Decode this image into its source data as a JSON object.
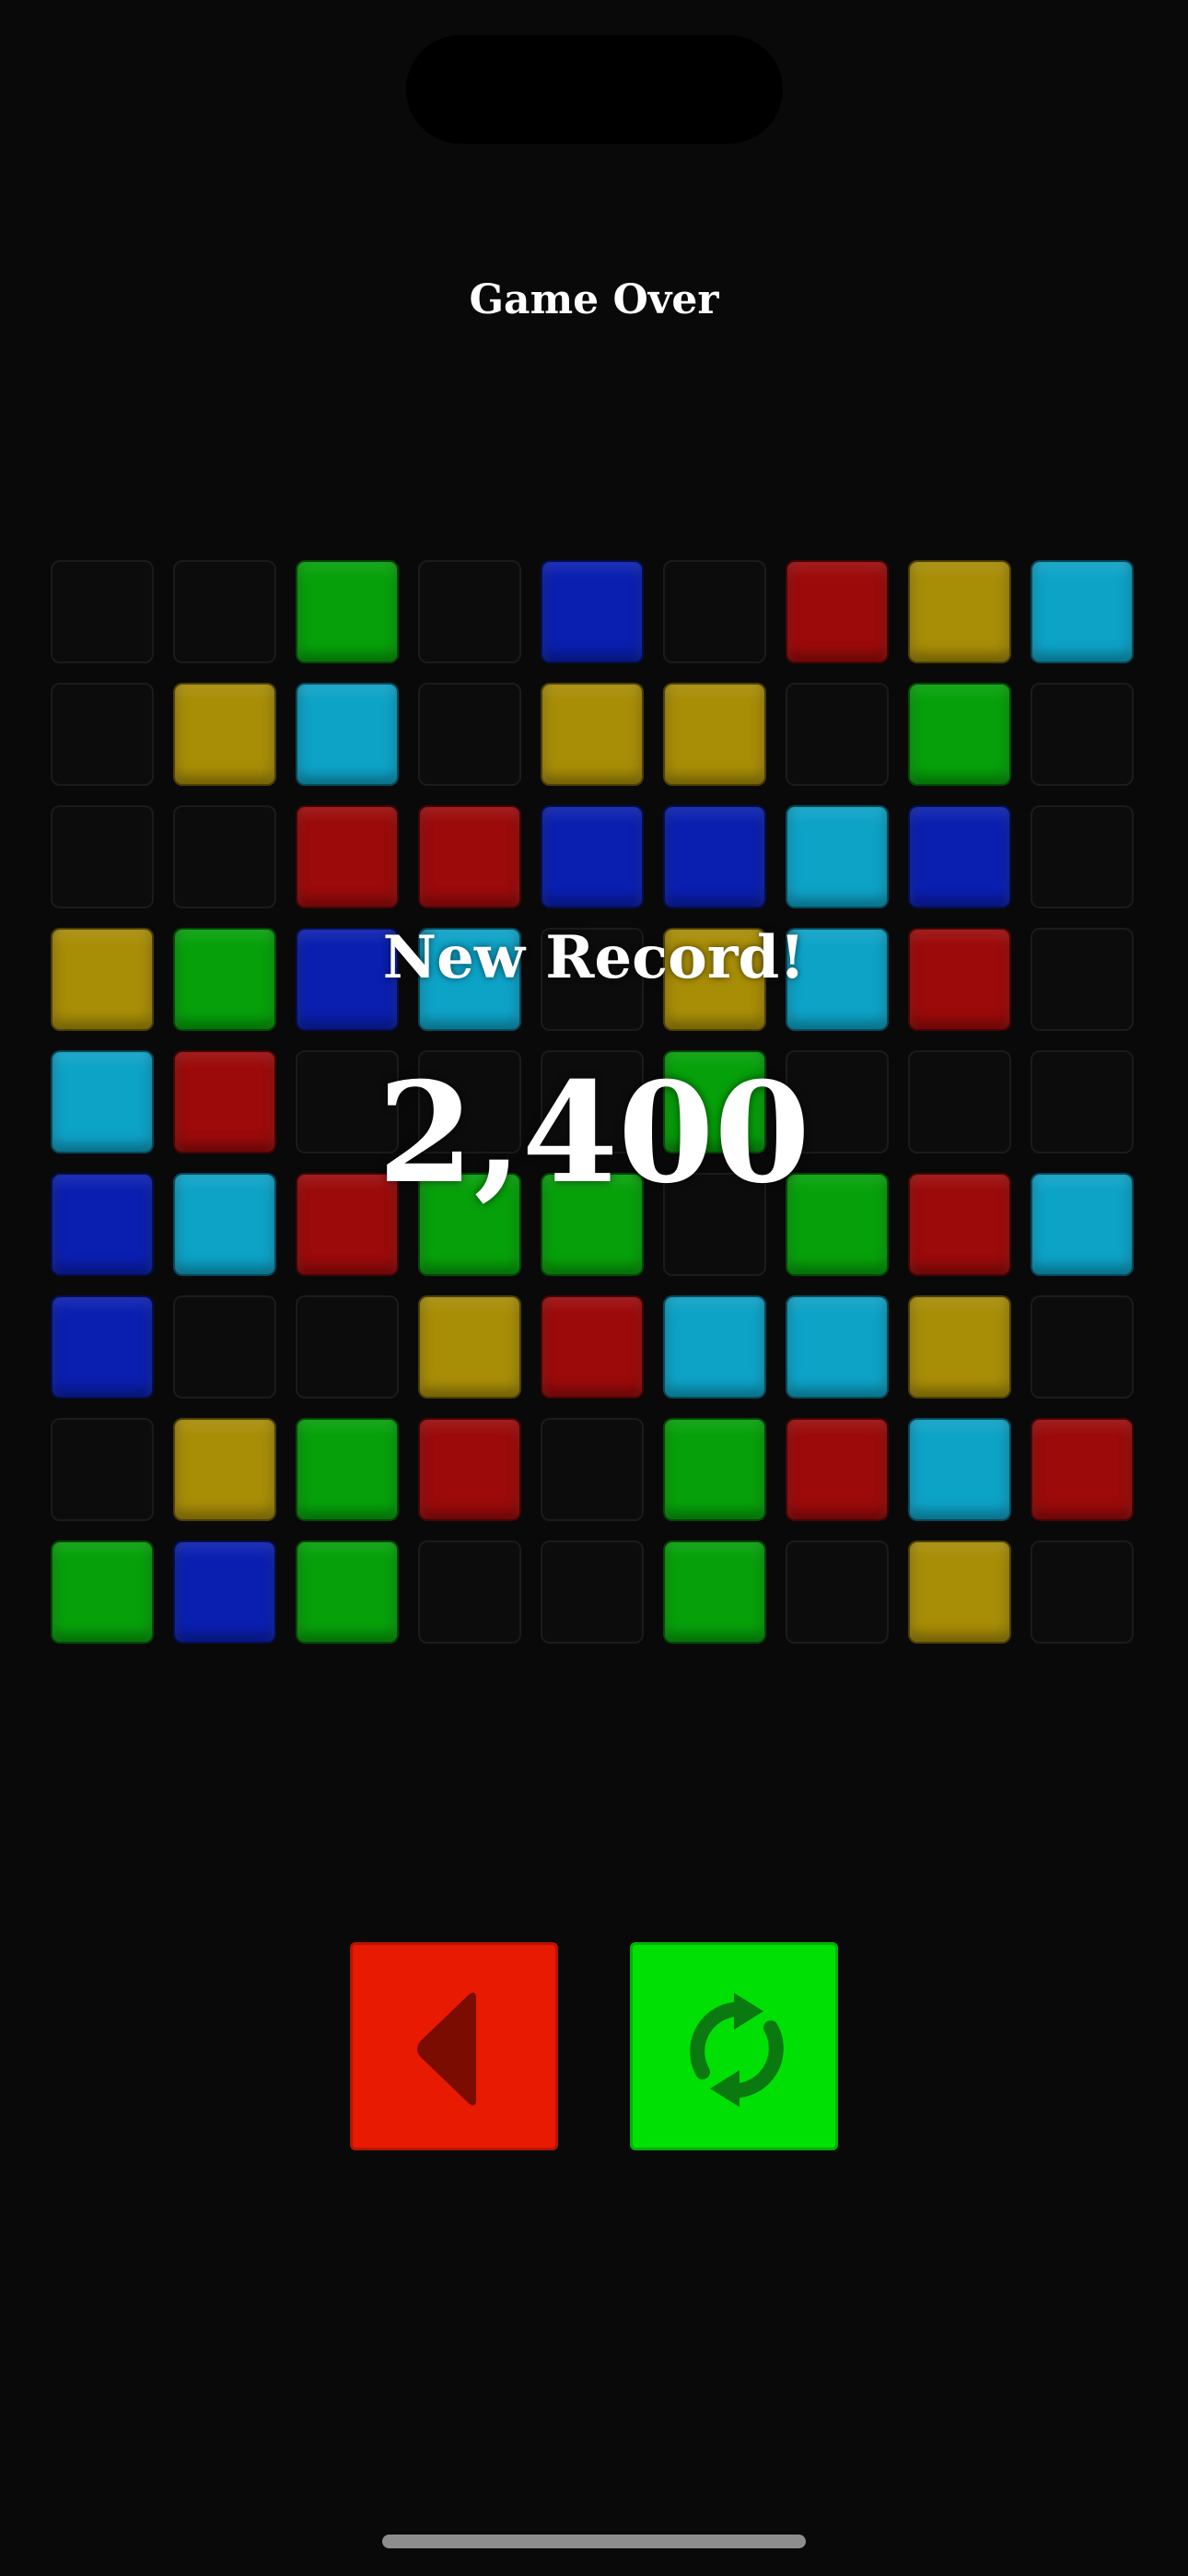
{
  "screen": {
    "title": "Game Over",
    "record_label": "New Record!",
    "score": "2,400"
  },
  "colors": {
    "R": "#9c0a0a",
    "G": "#06a10a",
    "B": "#0a1fb0",
    "C": "#0da3c7",
    "Y": "#a88d07",
    "back_button": "#e81a02",
    "restart_button": "#00e005"
  },
  "board": {
    "rows": 9,
    "cols": 9,
    "cells": [
      [
        ".",
        ".",
        "G",
        ".",
        "B",
        ".",
        "R",
        "Y",
        "C"
      ],
      [
        ".",
        "Y",
        "C",
        ".",
        "Y",
        "Y",
        ".",
        "G",
        "."
      ],
      [
        ".",
        ".",
        "R",
        "R",
        "B",
        "B",
        "C",
        "B",
        "."
      ],
      [
        "Y",
        "G",
        "B",
        "C",
        ".",
        "Y",
        "C",
        "R",
        "."
      ],
      [
        "C",
        "R",
        ".",
        ".",
        ".",
        "G",
        ".",
        ".",
        "."
      ],
      [
        "B",
        "C",
        "R",
        "G",
        "G",
        ".",
        "G",
        "R",
        "C"
      ],
      [
        "B",
        ".",
        ".",
        "Y",
        "R",
        "C",
        "C",
        "Y",
        "."
      ],
      [
        ".",
        "Y",
        "G",
        "R",
        ".",
        "G",
        "R",
        "C",
        "R"
      ],
      [
        "G",
        "B",
        "G",
        ".",
        ".",
        "G",
        ".",
        "Y",
        "."
      ]
    ]
  },
  "buttons": [
    {
      "name": "back-button",
      "icon": "triangle-left-icon"
    },
    {
      "name": "restart-button",
      "icon": "refresh-icon"
    }
  ]
}
